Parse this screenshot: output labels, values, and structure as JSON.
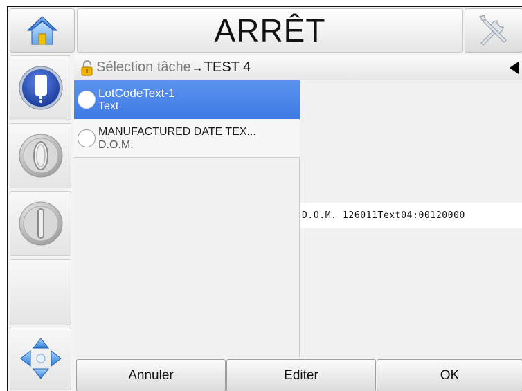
{
  "header": {
    "status_title": "ARRÊT",
    "home_icon": "home-icon",
    "tools_icon": "tools-icon"
  },
  "nav": {
    "items": [
      {
        "icon": "printer-icon"
      },
      {
        "icon": "jet-start-icon"
      },
      {
        "icon": "jet-stop-icon"
      },
      {
        "icon": "empty-slot"
      },
      {
        "icon": "navigation-arrows-icon"
      }
    ]
  },
  "breadcrumb": {
    "root": "Sélection tâche",
    "arrow": "→",
    "leaf": "TEST 4"
  },
  "jobs": [
    {
      "name": "LotCodeText-1",
      "type": "Text",
      "selected": true
    },
    {
      "name": "MANUFACTURED DATE TEX...",
      "type": "D.O.M.",
      "selected": false
    }
  ],
  "preview": {
    "text": "D.O.M. 126011Text04:00120000"
  },
  "footer": {
    "cancel_label": "Annuler",
    "edit_label": "Editer",
    "ok_label": "OK"
  },
  "colors": {
    "selection": "#4a86ea",
    "nav_blue": "#2d55c8"
  }
}
